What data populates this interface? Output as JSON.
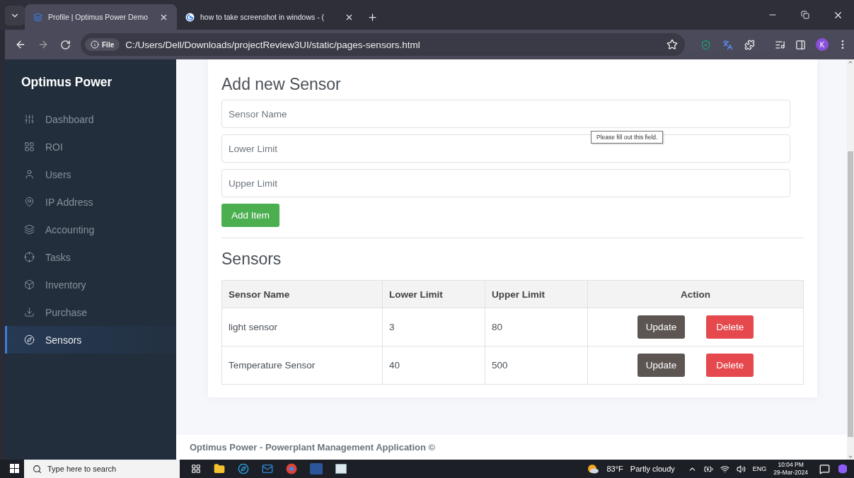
{
  "browser": {
    "tabs": [
      {
        "title": "Profile | Optimus Power Demo",
        "selected": true
      },
      {
        "title": "how to take screenshot in windows - (",
        "selected": false
      }
    ],
    "address": {
      "badge": "File",
      "url": "C:/Users/Dell/Downloads/projectReview3UI/static/pages-sensors.html"
    },
    "avatar": "K"
  },
  "sidebar": {
    "brand": "Optimus Power",
    "items": [
      {
        "label": "Dashboard",
        "selected": false
      },
      {
        "label": "ROI",
        "selected": false
      },
      {
        "label": "Users",
        "selected": false
      },
      {
        "label": "IP Address",
        "selected": false
      },
      {
        "label": "Accounting",
        "selected": false
      },
      {
        "label": "Tasks",
        "selected": false
      },
      {
        "label": "Inventory",
        "selected": false
      },
      {
        "label": "Purchase",
        "selected": false
      },
      {
        "label": "Sensors",
        "selected": true
      }
    ]
  },
  "form": {
    "title": "Add new Sensor",
    "fields": [
      {
        "placeholder": "Sensor Name"
      },
      {
        "placeholder": "Lower Limit"
      },
      {
        "placeholder": "Upper Limit"
      }
    ],
    "tooltip": "Please fill out this field.",
    "button": "Add Item"
  },
  "sensors": {
    "title": "Sensors",
    "columns": [
      "Sensor Name",
      "Lower Limit",
      "Upper Limit",
      "Action"
    ],
    "rows": [
      {
        "name": "light sensor",
        "lower": "3",
        "upper": "80",
        "update": "Update",
        "delete": "Delete"
      },
      {
        "name": "Temperature Sensor",
        "lower": "40",
        "upper": "500",
        "update": "Update",
        "delete": "Delete"
      }
    ]
  },
  "footer": "Optimus Power - Powerplant Management Application ©",
  "taskbar": {
    "search": "Type here to search",
    "temperature": "83°F",
    "weather": "Partly cloudy",
    "language": "ENG",
    "time": "10:04 PM",
    "date": "29-Mar-2024"
  }
}
